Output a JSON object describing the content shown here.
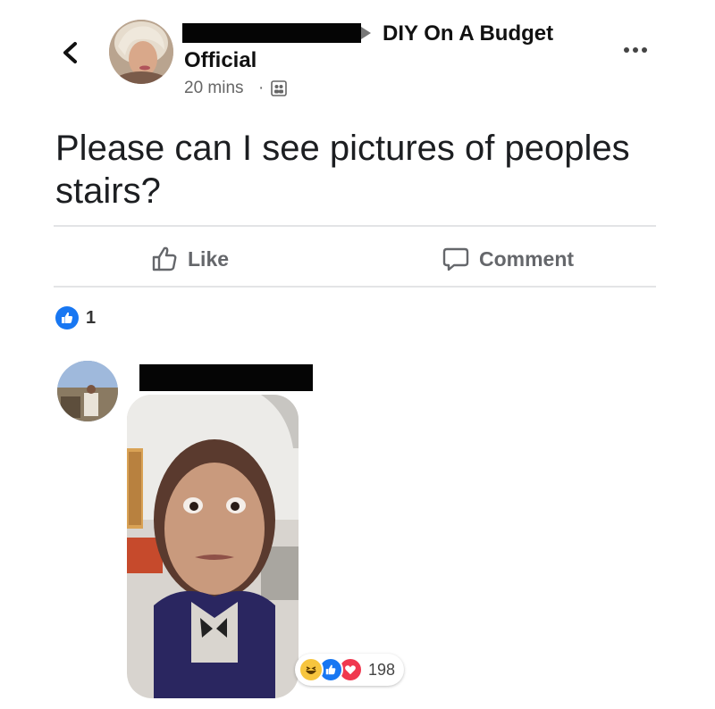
{
  "header": {
    "back_glyph": "<",
    "group_name": "DIY On A Budget",
    "author_suffix": "Official",
    "time": "20 mins",
    "separator": "·",
    "more_glyph": "•••",
    "privacy_icon": "group-audience-icon"
  },
  "post": {
    "text": "Please can I see pictures of peoples stairs?"
  },
  "actions": {
    "like_label": "Like",
    "comment_label": "Comment"
  },
  "reactions": {
    "count": "1",
    "icon": "like-icon"
  },
  "comment": {
    "reaction_icons": [
      "haha-icon",
      "like-icon",
      "love-icon"
    ],
    "reaction_count": "198"
  },
  "colors": {
    "facebook_blue": "#1877f2",
    "love_red": "#f0384f",
    "haha_yellow": "#f7c53e",
    "muted_text": "#65676b",
    "redaction": "#050505"
  }
}
